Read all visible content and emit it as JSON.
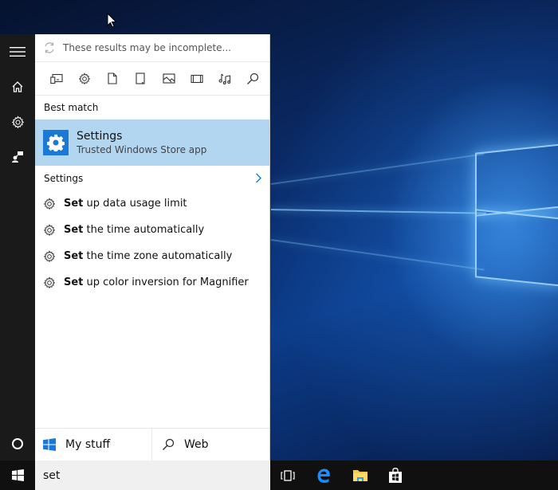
{
  "search": {
    "incomplete_notice": "These results may be incomplete...",
    "query": "set"
  },
  "filters": [
    {
      "icon": "apps-icon"
    },
    {
      "icon": "settings-icon"
    },
    {
      "icon": "documents-icon"
    },
    {
      "icon": "folders-icon"
    },
    {
      "icon": "photos-icon"
    },
    {
      "icon": "videos-icon"
    },
    {
      "icon": "music-icon"
    },
    {
      "icon": "web-search-icon"
    }
  ],
  "best_match": {
    "section_label": "Best match",
    "title": "Settings",
    "subtitle": "Trusted Windows Store app",
    "tile_color": "#1979d4",
    "highlight_color": "#b3d6f0"
  },
  "settings_section": {
    "label": "Settings",
    "results": [
      {
        "bold": "Set",
        "rest": " up data usage limit"
      },
      {
        "bold": "Set",
        "rest": " the time automatically"
      },
      {
        "bold": "Set",
        "rest": " the time zone automatically"
      },
      {
        "bold": "Set",
        "rest": " up color inversion for Magnifier"
      }
    ]
  },
  "scopes": {
    "my_stuff": "My stuff",
    "web": "Web"
  },
  "rail": {
    "items": [
      "menu-icon",
      "home-icon",
      "settings-icon",
      "feedback-icon",
      "cortana-icon"
    ]
  },
  "taskbar": {
    "items": [
      "task-view-icon",
      "edge-icon",
      "file-explorer-icon",
      "store-icon"
    ]
  },
  "colors": {
    "accent": "#1979d4",
    "rail": "#1a1a1a",
    "taskbar": "#101010"
  }
}
